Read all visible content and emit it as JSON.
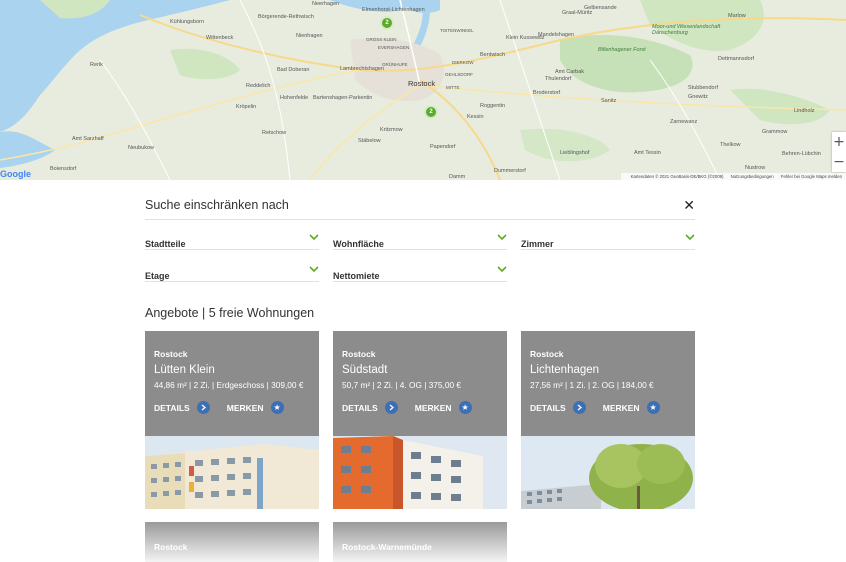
{
  "map": {
    "labels": {
      "neuhagen": "Neerhagen",
      "elmenhorst": "Elmenhorst-Lichtenhagen",
      "kuehlungsborn": "Kühlungsborn",
      "boergerende": "Börgerende-Rethwisch",
      "stuenbrook": "Stäbelow",
      "wittenbeck": "Wittenbeck",
      "nienhagen": "Nienhagen",
      "gelbensande": "Gelbensande",
      "graal": "Graal-Müritz",
      "marlow": "Marlow",
      "mandelshagen": "Mandelshagen",
      "moor": "Moor-und Wiesenlandschaft Dänschenburg",
      "bentwisch": "Bentwisch",
      "klein_kussewitz": "Klein Kussewitz",
      "billenhagen": "Billenhagener Forst",
      "rerik": "Rerik",
      "bad_doberan": "Bad Doberan",
      "lambrechtshagen": "Lambrechtshagen",
      "rostock": "Rostock",
      "amt_carbak": "Amt Carbak",
      "thulendorf": "Thulendorf",
      "dettmannsdorf": "Dettmannsdorf",
      "reddelich": "Reddelich",
      "hohenfelde": "Hohenfelde",
      "bartenshagen": "Bartenshagen-Parkentin",
      "broderstorf": "Broderstorf",
      "stubbendorf": "Stubbendorf",
      "kroepelin": "Kröpelin",
      "roggentin": "Roggentin",
      "sanitz": "Sanitz",
      "gnewitz": "Gnewitz",
      "zarnewanz": "Zarnewanz",
      "lindholz": "Lindholz",
      "retschow": "Retschow",
      "kritzmow": "Kritzmow",
      "kessin": "Kessin",
      "grammow": "Grammow",
      "neubukow": "Neubukow",
      "staebelow": "Stäbelow",
      "amt_satow": "Amt Sarzhaff",
      "papendorf": "Papendorf",
      "lieblingshof": "Lieblingshof",
      "amt_tessin": "Amt Tessin",
      "thelkow": "Thelkow",
      "bobitz": "Boiensdorf",
      "dummerstorf": "Dummerstorf",
      "nustrow": "Nustrow",
      "bfw_luebchin": "Behren-Lübchin",
      "damm": "Damm",
      "gross_stove": "GROSS KLEIN",
      "mitte": "MITTE",
      "evershagen": "EVERSHAGEN",
      "gruenhufe": "GRÜNHUFE",
      "toitenwinkel": "TOITENWINKEL",
      "gehlsdorf": "GEHLSDORF",
      "dierkow": "DIERKOW"
    },
    "clusters": [
      "2",
      "2"
    ],
    "footer": {
      "attribution": "Kartendaten © 2021 GeoBasis-DE/BKG (©2009)",
      "terms": "Nutzungsbedingungen",
      "report": "Fehler bei Google Maps melden"
    },
    "logo": "Google",
    "zoom_in": "+",
    "zoom_out": "−"
  },
  "filter": {
    "title": "Suche einschränken nach",
    "close": "✕",
    "dropdowns": [
      {
        "label": "Stadtteile"
      },
      {
        "label": "Wohnfläche"
      },
      {
        "label": "Zimmer"
      },
      {
        "label": "Etage"
      },
      {
        "label": "Nettomiete"
      }
    ]
  },
  "offers": {
    "title": "Angebote | 5 freie Wohnungen",
    "details_label": "DETAILS",
    "merken_label": "MERKEN",
    "cards": [
      {
        "city": "Rostock",
        "district": "Lütten Klein",
        "info": "44,86 m² | 2 Zi. | Erdgeschoss | 309,00 €"
      },
      {
        "city": "Rostock",
        "district": "Südstadt",
        "info": "50,7 m² | 2 Zi. | 4. OG | 375,00 €"
      },
      {
        "city": "Rostock",
        "district": "Lichtenhagen",
        "info": "27,56 m² | 1 Zi. | 2. OG | 184,00 €"
      },
      {
        "city": "Rostock"
      },
      {
        "city": "Rostock-Warnemünde"
      }
    ]
  },
  "colors": {
    "accent_green": "#5bab2a",
    "button_blue": "#3d6fb5",
    "card_gray": "#8c8c8c",
    "water": "#aad3f0"
  }
}
